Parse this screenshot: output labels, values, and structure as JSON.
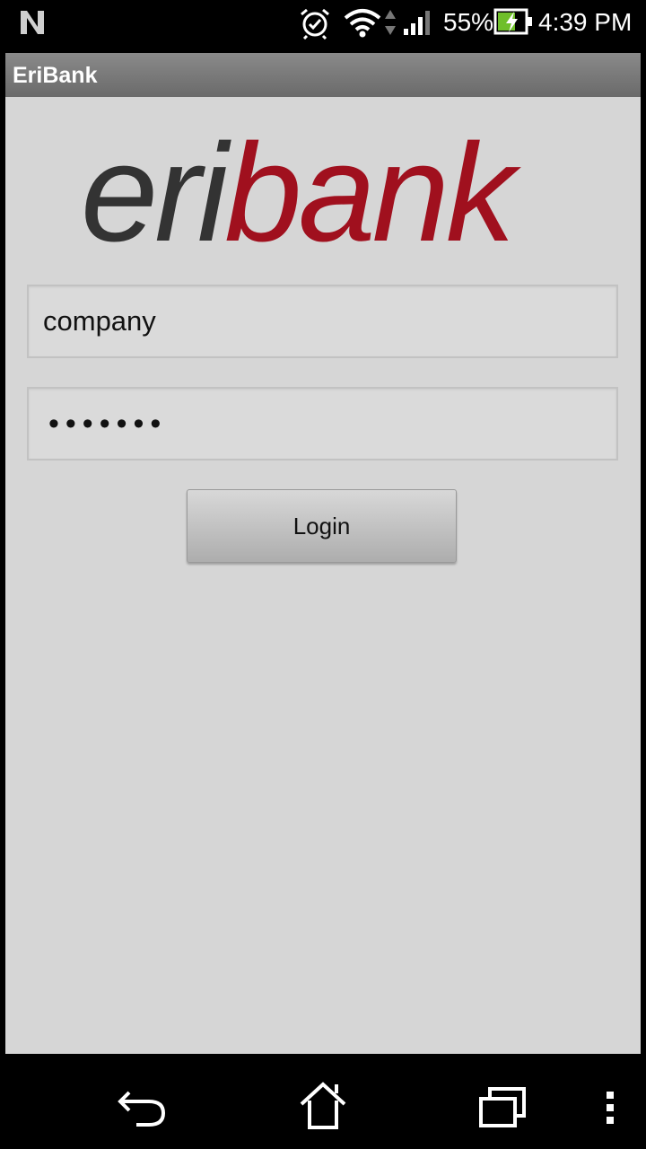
{
  "status_bar": {
    "battery_percent": "55%",
    "time": "4:39 PM",
    "icons": [
      "n-notification-icon",
      "alarm-icon",
      "wifi-icon",
      "data-activity-icon",
      "signal-icon",
      "battery-charging-icon"
    ],
    "battery_color": "#6fbf2a"
  },
  "action_bar": {
    "title": "EriBank"
  },
  "login": {
    "logo_text_dark": "eri",
    "logo_text_red": "bank",
    "logo_dark_color": "#333333",
    "logo_red_color": "#a0101e",
    "username_value": "company",
    "password_masked": "•••••••",
    "login_label": "Login"
  },
  "nav_bar": {
    "icons": [
      "back-icon",
      "home-icon",
      "recents-icon",
      "overflow-menu-icon"
    ]
  }
}
